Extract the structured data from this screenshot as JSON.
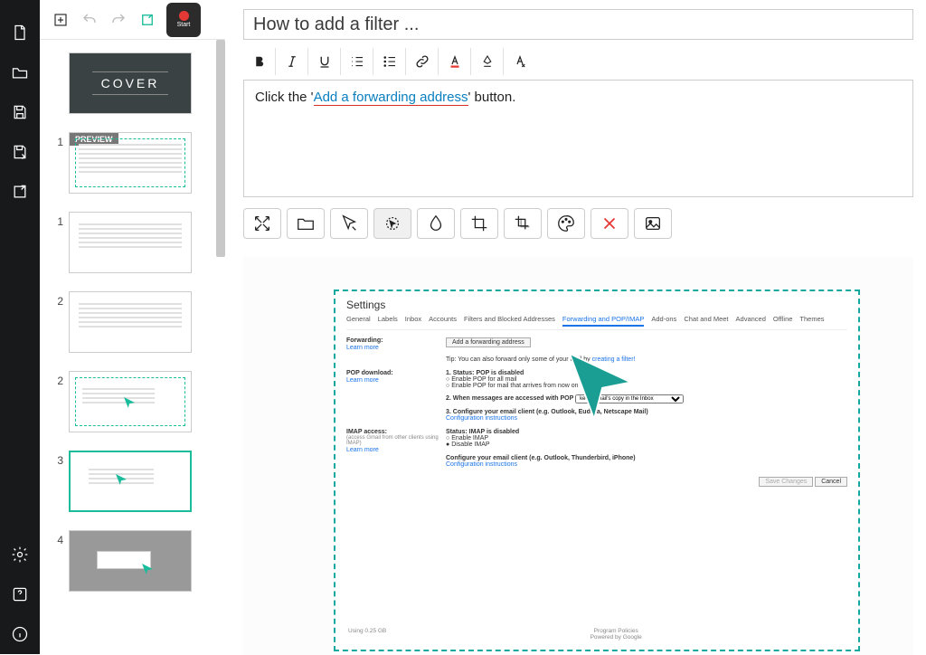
{
  "toolbar": {
    "record_label": "Start"
  },
  "sidebar_icons": [
    "new-document-icon",
    "open-folder-icon",
    "save-icon",
    "save-as-icon",
    "export-icon",
    "settings-icon",
    "help-icon",
    "info-icon"
  ],
  "slides": {
    "cover_label": "COVER",
    "preview_badge": "PREVIEW",
    "items": [
      {
        "num": "1"
      },
      {
        "num": "1"
      },
      {
        "num": "2"
      },
      {
        "num": "2"
      },
      {
        "num": "3"
      },
      {
        "num": "4"
      }
    ]
  },
  "editor": {
    "title": "How to add a filter ...",
    "description_pre": "Click the '",
    "description_link": "Add a forwarding address",
    "description_post": "' button."
  },
  "img_tools": [
    "expand",
    "folder",
    "pointer",
    "spotlight",
    "blur",
    "crop",
    "multi-crop",
    "palette",
    "delete",
    "image"
  ],
  "settings": {
    "title": "Settings",
    "tabs": [
      "General",
      "Labels",
      "Inbox",
      "Accounts",
      "Filters and Blocked Addresses",
      "Forwarding and POP/IMAP",
      "Add-ons",
      "Chat and Meet",
      "Advanced",
      "Offline",
      "Themes"
    ],
    "active_tab": "Forwarding and POP/IMAP",
    "forwarding": {
      "label": "Forwarding:",
      "learn": "Learn more",
      "btn": "Add a forwarding address",
      "tip_pre": "Tip: You can also forward only some of your mail by ",
      "tip_link": "creating a filter!"
    },
    "pop": {
      "label": "POP download:",
      "learn": "Learn more",
      "s1": "1. Status: POP is disabled",
      "o1": "Enable POP for all mail",
      "o2": "Enable POP for mail that arrives from now on",
      "s2": "2. When messages are accessed with POP",
      "sel": "keep Gmail's copy in the Inbox",
      "s3": "3. Configure your email client (e.g. Outlook, Eudora, Netscape Mail)",
      "cfg": "Configuration instructions"
    },
    "imap": {
      "label": "IMAP access:",
      "sub": "(access Gmail from other clients using IMAP)",
      "learn": "Learn more",
      "status": "Status: IMAP is disabled",
      "o1": "Enable IMAP",
      "o2": "Disable IMAP",
      "s3": "Configure your email client (e.g. Outlook, Thunderbird, iPhone)",
      "cfg": "Configuration instructions"
    },
    "save": "Save Changes",
    "cancel": "Cancel",
    "footer_left": "Using 0.25 GB",
    "footer_c1": "Program Policies",
    "footer_c2": "Powered by Google"
  }
}
